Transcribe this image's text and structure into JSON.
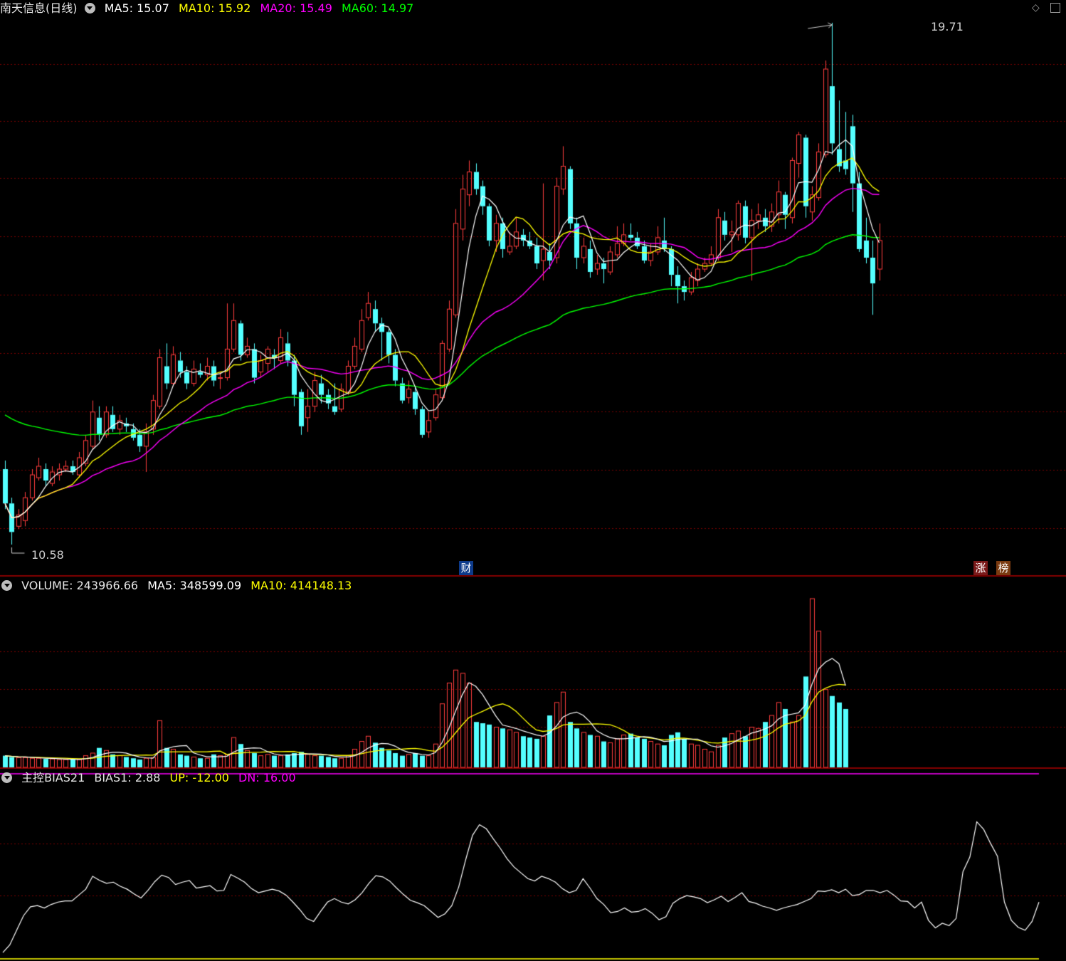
{
  "header_main": {
    "stock_name": "南天信息(日线)",
    "ma5": "MA5: 15.07",
    "ma10": "MA10: 15.92",
    "ma20": "MA20: 15.49",
    "ma60": "MA60: 14.97"
  },
  "header_volume": {
    "volume": "VOLUME: 243966.66",
    "ma5": "MA5: 348599.09",
    "ma10": "MA10: 414148.13"
  },
  "header_bias": {
    "name": "主控BIAS21",
    "bias1": "BIAS1: 2.88",
    "up": "UP: -12.00",
    "dn": "DN: 16.00"
  },
  "annotations": {
    "high_label": "19.71",
    "low_label": "10.58"
  },
  "badges": {
    "cai": "财",
    "zhang": "涨",
    "bang": "榜"
  },
  "icons": {
    "dropdown": "chevron-down-icon",
    "diamond": "diamond-icon",
    "window": "restore-window-icon"
  },
  "colors": {
    "up_candle": "#ff3c3c",
    "down_candle": "#54ffff",
    "ma5": "#ffffff",
    "ma10": "#ffff00",
    "ma20": "#ff00ff",
    "ma60": "#00ff00",
    "grid": "#7a0000",
    "bias_line": "#ffffff",
    "level_line": "#ff00ff"
  },
  "chart_data": {
    "type": "candlestick",
    "price_range": [
      10.58,
      19.71
    ],
    "price_extremes": {
      "high": 19.71,
      "low": 10.58
    },
    "bars": [
      [
        11.9,
        11.3,
        12.05,
        11.2
      ],
      [
        11.3,
        10.8,
        11.4,
        10.58
      ],
      [
        10.9,
        11.1,
        11.2,
        10.85
      ],
      [
        11.0,
        11.4,
        11.5,
        10.9
      ],
      [
        11.4,
        11.8,
        11.9,
        11.35
      ],
      [
        11.75,
        11.95,
        12.1,
        11.7
      ],
      [
        11.9,
        11.7,
        12.0,
        11.6
      ],
      [
        11.65,
        11.85,
        11.95,
        11.6
      ],
      [
        11.8,
        11.9,
        12.0,
        11.7
      ],
      [
        11.9,
        11.95,
        12.05,
        11.85
      ],
      [
        11.95,
        11.85,
        12.05,
        11.8
      ],
      [
        11.8,
        12.1,
        12.2,
        11.75
      ],
      [
        12.0,
        12.4,
        12.5,
        11.95
      ],
      [
        12.3,
        12.9,
        13.1,
        12.25
      ],
      [
        12.8,
        12.5,
        13.0,
        12.4
      ],
      [
        12.5,
        12.9,
        13.0,
        12.45
      ],
      [
        12.85,
        12.6,
        13.0,
        12.55
      ],
      [
        12.6,
        12.75,
        12.85,
        12.5
      ],
      [
        12.7,
        12.65,
        12.8,
        12.55
      ],
      [
        12.6,
        12.45,
        12.7,
        12.4
      ],
      [
        12.5,
        12.3,
        12.6,
        12.2
      ],
      [
        12.3,
        12.55,
        12.7,
        11.85
      ],
      [
        12.6,
        13.1,
        13.2,
        12.5
      ],
      [
        13.0,
        13.85,
        14.0,
        12.95
      ],
      [
        13.7,
        13.4,
        14.1,
        13.3
      ],
      [
        13.4,
        13.9,
        14.05,
        13.35
      ],
      [
        13.8,
        13.6,
        13.95,
        13.5
      ],
      [
        13.6,
        13.4,
        13.7,
        13.3
      ],
      [
        13.4,
        13.65,
        13.8,
        13.35
      ],
      [
        13.6,
        13.55,
        13.75,
        13.5
      ],
      [
        13.55,
        13.7,
        13.85,
        13.45
      ],
      [
        13.7,
        13.45,
        13.8,
        13.35
      ],
      [
        13.5,
        13.5,
        13.6,
        13.3
      ],
      [
        13.5,
        14.0,
        14.8,
        13.45
      ],
      [
        14.0,
        14.5,
        14.8,
        13.95
      ],
      [
        14.45,
        13.9,
        14.5,
        13.8
      ],
      [
        13.9,
        14.05,
        14.2,
        13.85
      ],
      [
        14.0,
        13.5,
        14.1,
        13.4
      ],
      [
        13.6,
        13.8,
        13.9,
        13.5
      ],
      [
        13.75,
        14.0,
        14.05,
        13.6
      ],
      [
        13.9,
        13.85,
        14.0,
        13.65
      ],
      [
        13.8,
        14.2,
        14.35,
        13.75
      ],
      [
        14.1,
        13.8,
        14.3,
        13.7
      ],
      [
        13.8,
        13.2,
        13.9,
        13.0
      ],
      [
        13.25,
        12.65,
        13.3,
        12.5
      ],
      [
        12.8,
        13.0,
        13.3,
        12.55
      ],
      [
        13.0,
        13.45,
        13.6,
        12.9
      ],
      [
        13.4,
        13.2,
        13.55,
        13.05
      ],
      [
        13.2,
        13.05,
        13.3,
        12.95
      ],
      [
        13.0,
        12.9,
        13.4,
        12.85
      ],
      [
        12.95,
        13.3,
        13.4,
        12.9
      ],
      [
        13.25,
        13.7,
        13.8,
        13.2
      ],
      [
        13.7,
        14.05,
        14.2,
        13.65
      ],
      [
        14.0,
        14.5,
        14.7,
        13.95
      ],
      [
        14.55,
        14.8,
        15.0,
        14.5
      ],
      [
        14.7,
        14.45,
        14.85,
        14.3
      ],
      [
        14.45,
        14.3,
        14.55,
        13.8
      ],
      [
        14.3,
        13.9,
        14.35,
        13.75
      ],
      [
        13.9,
        13.45,
        14.0,
        13.35
      ],
      [
        13.4,
        13.1,
        13.5,
        13.05
      ],
      [
        13.15,
        13.3,
        13.45,
        13.05
      ],
      [
        13.25,
        12.95,
        13.35,
        12.85
      ],
      [
        12.95,
        12.5,
        13.0,
        12.45
      ],
      [
        12.55,
        12.75,
        12.9,
        12.45
      ],
      [
        12.8,
        13.2,
        13.3,
        12.75
      ],
      [
        13.15,
        14.1,
        14.15,
        13.1
      ],
      [
        14.0,
        14.7,
        14.85,
        13.95
      ],
      [
        14.6,
        16.2,
        16.45,
        14.55
      ],
      [
        16.1,
        16.8,
        17.05,
        15.9
      ],
      [
        16.7,
        17.1,
        17.3,
        16.5
      ],
      [
        17.1,
        16.8,
        17.25,
        16.7
      ],
      [
        16.85,
        16.5,
        16.95,
        16.35
      ],
      [
        16.5,
        15.9,
        16.55,
        15.8
      ],
      [
        15.9,
        16.2,
        16.35,
        15.7
      ],
      [
        16.2,
        15.75,
        16.3,
        15.6
      ],
      [
        15.7,
        15.8,
        16.05,
        15.65
      ],
      [
        15.8,
        16.05,
        16.3,
        15.75
      ],
      [
        16.0,
        15.9,
        16.1,
        15.8
      ],
      [
        15.9,
        15.8,
        16.05,
        15.75
      ],
      [
        15.8,
        15.5,
        15.95,
        15.4
      ],
      [
        15.55,
        15.75,
        16.9,
        15.2
      ],
      [
        15.7,
        15.55,
        15.85,
        15.4
      ],
      [
        15.6,
        16.85,
        17.0,
        15.5
      ],
      [
        16.8,
        17.2,
        17.55,
        16.7
      ],
      [
        17.15,
        16.2,
        17.2,
        16.1
      ],
      [
        16.2,
        15.6,
        16.3,
        15.4
      ],
      [
        15.6,
        15.8,
        15.95,
        15.5
      ],
      [
        15.75,
        15.35,
        15.9,
        15.25
      ],
      [
        15.4,
        15.5,
        15.65,
        15.3
      ],
      [
        15.5,
        15.4,
        15.6,
        15.15
      ],
      [
        15.35,
        15.7,
        15.8,
        15.3
      ],
      [
        15.65,
        15.85,
        16.15,
        15.6
      ],
      [
        15.85,
        16.0,
        16.2,
        15.8
      ],
      [
        16.0,
        15.95,
        16.2,
        15.9
      ],
      [
        15.95,
        15.8,
        16.05,
        15.75
      ],
      [
        15.8,
        15.55,
        15.9,
        15.5
      ],
      [
        15.55,
        15.7,
        15.85,
        15.45
      ],
      [
        15.7,
        15.95,
        16.15,
        15.65
      ],
      [
        15.9,
        15.75,
        16.3,
        15.7
      ],
      [
        15.75,
        15.3,
        15.8,
        15.1
      ],
      [
        15.3,
        15.1,
        15.45,
        14.8
      ],
      [
        15.1,
        15.0,
        15.2,
        14.85
      ],
      [
        15.0,
        15.25,
        15.35,
        14.95
      ],
      [
        15.2,
        15.4,
        15.5,
        15.1
      ],
      [
        15.4,
        15.5,
        15.6,
        15.35
      ],
      [
        15.5,
        15.65,
        15.8,
        15.45
      ],
      [
        15.6,
        16.3,
        16.45,
        15.55
      ],
      [
        16.25,
        16.0,
        16.4,
        15.9
      ],
      [
        16.0,
        16.05,
        16.25,
        15.7
      ],
      [
        16.0,
        16.55,
        16.6,
        15.9
      ],
      [
        16.5,
        15.95,
        16.6,
        15.85
      ],
      [
        15.95,
        16.25,
        16.45,
        15.2
      ],
      [
        16.25,
        16.35,
        16.55,
        16.1
      ],
      [
        16.3,
        16.15,
        16.45,
        16.05
      ],
      [
        16.15,
        16.4,
        16.55,
        16.05
      ],
      [
        16.35,
        16.75,
        16.95,
        16.2
      ],
      [
        16.7,
        16.35,
        16.75,
        16.1
      ],
      [
        16.3,
        17.3,
        17.35,
        16.2
      ],
      [
        17.25,
        17.75,
        17.8,
        17.0
      ],
      [
        17.7,
        16.5,
        17.75,
        16.3
      ],
      [
        16.4,
        16.7,
        16.85,
        16.25
      ],
      [
        16.65,
        17.45,
        17.6,
        16.6
      ],
      [
        17.4,
        18.9,
        19.05,
        17.35
      ],
      [
        18.6,
        17.6,
        19.71,
        17.4
      ],
      [
        17.5,
        17.2,
        18.35,
        17.1
      ],
      [
        17.3,
        17.15,
        18.15,
        17.05
      ],
      [
        17.9,
        16.9,
        18.1,
        16.4
      ],
      [
        16.9,
        15.75,
        17.1,
        15.7
      ],
      [
        15.9,
        15.6,
        16.3,
        15.5
      ],
      [
        15.6,
        15.15,
        15.9,
        14.6
      ],
      [
        15.4,
        15.9,
        16.2,
        15.2
      ]
    ],
    "volume": [
      18,
      16,
      15,
      15,
      14,
      14,
      13,
      13,
      12,
      12,
      12,
      12,
      18,
      22,
      30,
      26,
      20,
      18,
      16,
      14,
      12,
      14,
      15,
      72,
      30,
      28,
      20,
      18,
      16,
      14,
      14,
      20,
      18,
      20,
      46,
      36,
      26,
      22,
      18,
      20,
      18,
      18,
      20,
      22,
      24,
      20,
      18,
      18,
      16,
      14,
      14,
      18,
      28,
      40,
      48,
      38,
      30,
      26,
      22,
      18,
      20,
      22,
      18,
      18,
      36,
      98,
      130,
      150,
      145,
      130,
      70,
      68,
      66,
      62,
      60,
      58,
      54,
      48,
      46,
      44,
      48,
      80,
      100,
      116,
      70,
      60,
      54,
      50,
      48,
      40,
      38,
      44,
      50,
      52,
      46,
      44,
      40,
      36,
      34,
      50,
      54,
      44,
      36,
      34,
      28,
      24,
      34,
      46,
      52,
      56,
      48,
      62,
      60,
      70,
      80,
      100,
      90,
      70,
      80,
      140,
      260,
      210,
      120,
      110,
      100,
      90
    ],
    "bias": [
      -11.8,
      -10.5,
      -8.0,
      -5.5,
      -4.0,
      -3.8,
      -4.2,
      -3.6,
      -3.2,
      -3.0,
      -3.0,
      -2.0,
      -1.0,
      1.2,
      0.5,
      0.0,
      0.2,
      -0.5,
      -1.0,
      -1.8,
      -2.5,
      -1.2,
      0.3,
      1.4,
      1.0,
      -0.2,
      0.2,
      0.5,
      -0.8,
      -0.6,
      -0.4,
      -1.3,
      -1.2,
      1.5,
      0.9,
      0.2,
      -0.9,
      -1.6,
      -1.3,
      -1.0,
      -1.3,
      -2.0,
      -3.2,
      -4.5,
      -6.0,
      -6.5,
      -4.8,
      -3.2,
      -2.6,
      -3.2,
      -3.5,
      -2.8,
      -1.6,
      0.0,
      1.3,
      1.1,
      0.4,
      -0.8,
      -1.9,
      -2.9,
      -3.3,
      -3.8,
      -4.8,
      -5.8,
      -5.2,
      -3.8,
      -0.6,
      4.0,
      8.2,
      10.0,
      9.3,
      7.6,
      6.0,
      4.2,
      2.8,
      1.8,
      0.8,
      0.4,
      1.2,
      0.8,
      0.2,
      -0.9,
      -1.6,
      -1.2,
      0.8,
      -0.8,
      -2.6,
      -3.6,
      -5.0,
      -4.8,
      -4.2,
      -4.9,
      -4.8,
      -4.3,
      -5.1,
      -6.2,
      -5.7,
      -3.4,
      -2.6,
      -2.1,
      -2.3,
      -2.6,
      -3.3,
      -2.8,
      -2.2,
      -3.1,
      -2.4,
      -1.6,
      -3.1,
      -3.4,
      -3.9,
      -4.2,
      -4.6,
      -4.2,
      -3.9,
      -3.6,
      -3.1,
      -2.6,
      -1.3,
      -1.4,
      -1.1,
      -1.6,
      -1.0,
      -2.1,
      -1.9,
      -1.2,
      -1.2,
      -1.6,
      -1.2,
      -2.0,
      -3.0,
      -3.1,
      -4.2,
      -3.2,
      -6.3,
      -7.6,
      -6.8,
      -7.2,
      -6.0,
      2.0,
      4.5,
      10.5,
      9.2,
      6.8,
      4.6,
      -3.2,
      -6.3,
      -7.5,
      -8.0,
      -6.5,
      -3.2
    ],
    "bias_levels": {
      "up": -12.0,
      "dn": 16.0
    }
  }
}
